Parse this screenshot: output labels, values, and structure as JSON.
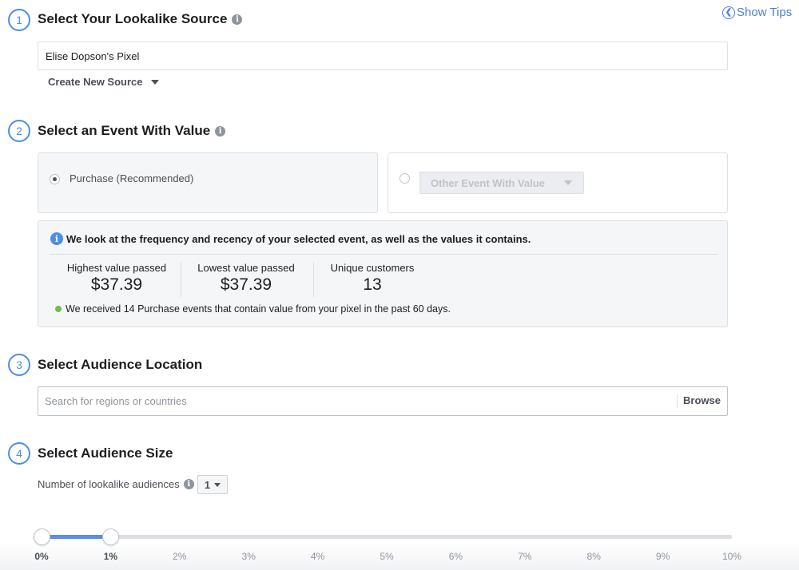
{
  "header": {
    "show_tips_label": "Show Tips",
    "show_tips_icon": "chevron-left-circle-icon"
  },
  "steps": [
    {
      "number": "1",
      "title": "Select Your Lookalike Source"
    },
    {
      "number": "2",
      "title": "Select an Event With Value"
    },
    {
      "number": "3",
      "title": "Select Audience Location"
    },
    {
      "number": "4",
      "title": "Select Audience Size"
    }
  ],
  "source": {
    "value": "Elise Dopson's Pixel",
    "create_new_label": "Create New Source"
  },
  "event": {
    "purchase_label": "Purchase (Recommended)",
    "purchase_selected": true,
    "other_event_label": "Other Event With Value",
    "other_selected": false
  },
  "stats": {
    "header": "We look at the frequency and recency of your selected event, as well as the values it contains.",
    "items": [
      {
        "label": "Highest value passed",
        "value": "$37.39"
      },
      {
        "label": "Lowest value passed",
        "value": "$37.39"
      },
      {
        "label": "Unique customers",
        "value": "13"
      }
    ],
    "footer": "We received 14 Purchase events that contain value from your pixel in the past 60 days."
  },
  "location": {
    "placeholder": "Search for regions or countries",
    "value": "",
    "browse_label": "Browse"
  },
  "size": {
    "num_audiences_label": "Number of lookalike audiences",
    "num_audiences_value": "1",
    "slider": {
      "min_percent": 0,
      "max_percent": 10,
      "range_start_percent": 0,
      "range_end_percent": 1,
      "ticks": [
        "0%",
        "1%",
        "2%",
        "3%",
        "4%",
        "5%",
        "6%",
        "7%",
        "8%",
        "9%",
        "10%"
      ]
    }
  },
  "colors": {
    "accent": "#4a90e2",
    "slider_fill": "#5b8def",
    "success_dot": "#6bbf4e"
  }
}
